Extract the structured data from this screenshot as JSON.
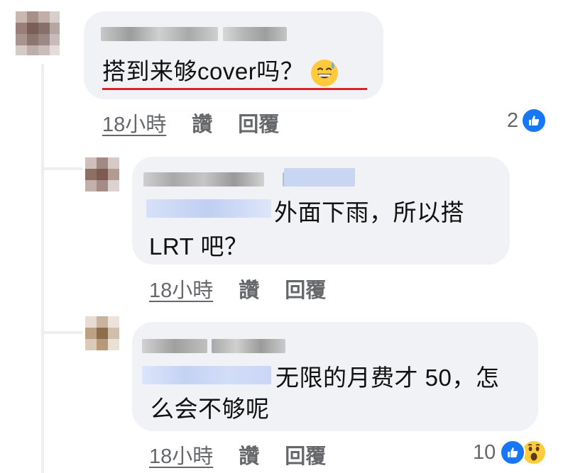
{
  "comments": [
    {
      "text_lines": [
        "搭到来够cover吗？"
      ],
      "emoji": "grinning-sweat-emoji",
      "time": "18小時",
      "like_label": "讚",
      "reply_label": "回覆",
      "reaction_count": "2",
      "reactions": [
        "like-icon"
      ]
    },
    {
      "text_lines": [
        "外面下雨，所以搭",
        "LRT 吧？"
      ],
      "time": "18小時",
      "like_label": "讚",
      "reply_label": "回覆"
    },
    {
      "text_lines": [
        "无限的月费才 50，怎",
        "么会不够呢"
      ],
      "time": "18小時",
      "like_label": "讚",
      "reply_label": "回覆",
      "reaction_count": "10",
      "reactions": [
        "like-icon",
        "wow-icon"
      ]
    }
  ],
  "colors": {
    "bubble": "#f0f2f5",
    "meta_text": "#65676b",
    "like_blue": "#1877f2",
    "highlight_red": "#e0222a"
  }
}
